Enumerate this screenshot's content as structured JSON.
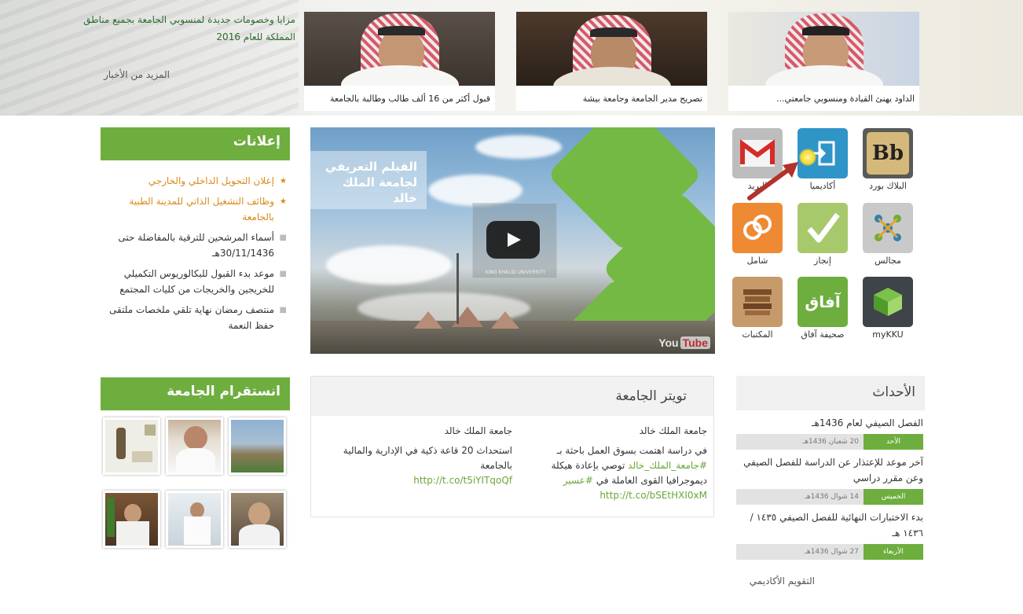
{
  "news": {
    "items": [
      {
        "caption": "الداود يهنئ القيادة ومنسوبي جامعتي..."
      },
      {
        "caption": "تصريح مدير الجامعة وجامعة بيشة"
      },
      {
        "caption": "قبول أكثر من 16 ألف طالب وطالبة بالجامعة"
      }
    ],
    "headline": "مزايا وخصومات جديدة لمنسوبي الجامعة بجميع مناطق المملكة للعام 2016",
    "more_link": "المزيد من الأخبار"
  },
  "apps": [
    {
      "label": "البلاك بورد",
      "icon": "blackboard-icon",
      "glyph": "Bb"
    },
    {
      "label": "أكاديميا",
      "icon": "academia-login-icon"
    },
    {
      "label": "البريد",
      "icon": "gmail-icon",
      "glyph": "M"
    },
    {
      "label": "مجالس",
      "icon": "councils-icon"
    },
    {
      "label": "إنجاز",
      "icon": "checkmark-icon"
    },
    {
      "label": "شامل",
      "icon": "rings-icon"
    },
    {
      "label": "myKKU",
      "icon": "mykku-cube-icon"
    },
    {
      "label": "صحيفة آفاق",
      "icon": "afaq-newspaper-icon",
      "glyph": "آفاق"
    },
    {
      "label": "المكتبات",
      "icon": "libraries-books-icon"
    }
  ],
  "video": {
    "title": "الفيلم التعريفي لجامعة الملك خالد",
    "watermark": "KING KHALID UNIVERSITY",
    "platform": "You",
    "platform_badge": "Tube"
  },
  "announcements": {
    "title": "إعلانات",
    "items": [
      {
        "text": "إعلان التحويل الداخلي والخارجي",
        "highlight": true
      },
      {
        "text": "وظائف التشغيل الذاتي للمدينة الطبية بالجامعة",
        "highlight": true
      },
      {
        "text": "أسماء المرشحين للترقية بالمفاضلة حتى 30/11/1436هـ",
        "highlight": false
      },
      {
        "text": "موعد بدء القبول للبكالوريوس التكميلي للخريجين والخريجات من كليات المجتمع",
        "highlight": false
      },
      {
        "text": "منتصف رمضان نهاية تلقي ملخصات ملتقى حفظ النعمة",
        "highlight": false
      }
    ]
  },
  "instagram": {
    "title": "انستقرام الجامعة"
  },
  "twitter": {
    "title": "تويتر الجامعة",
    "tweets": [
      {
        "author": "جامعة الملك خالد",
        "text_before": "في دراسة اهتمت بسوق العمل باحثة بـ",
        "hashtag1": "#جامعة_الملك_خالد",
        "text_mid": " توصي بإعادة هيكلة ديموجرافيا القوى العاملة في ",
        "hashtag2": "#عسير",
        "link": "http://t.co/bSEtHXI0xM"
      },
      {
        "author": "جامعة الملك خالد",
        "text_before": "استحداث 20 قاعة ذكية في الإدارية والمالية بالجامعة",
        "link": "http://t.co/t5iYITqoQf"
      }
    ]
  },
  "events": {
    "title": "الأحداث",
    "items": [
      {
        "title": "الفصل الصيفي لعام 1436هـ",
        "day": "الأحد",
        "date": "20 شعبان 1436هـ"
      },
      {
        "title": "آخر موعد للإعتذار عن الدراسة للفصل الصيفي وعن مقرر دراسي",
        "day": "الخميس",
        "date": "14 شوال 1436هـ"
      },
      {
        "title": "بدء الاختبارات النهائية للفصل الصيفي ١٤٣٥ / ١٤٣٦ هـ",
        "day": "الأربعاء",
        "date": "27 شوال 1436هـ"
      }
    ],
    "more_link": "التقويم الأكاديمي"
  },
  "colors": {
    "brand_green": "#6eae3f",
    "highlight_orange": "#d98a16"
  }
}
